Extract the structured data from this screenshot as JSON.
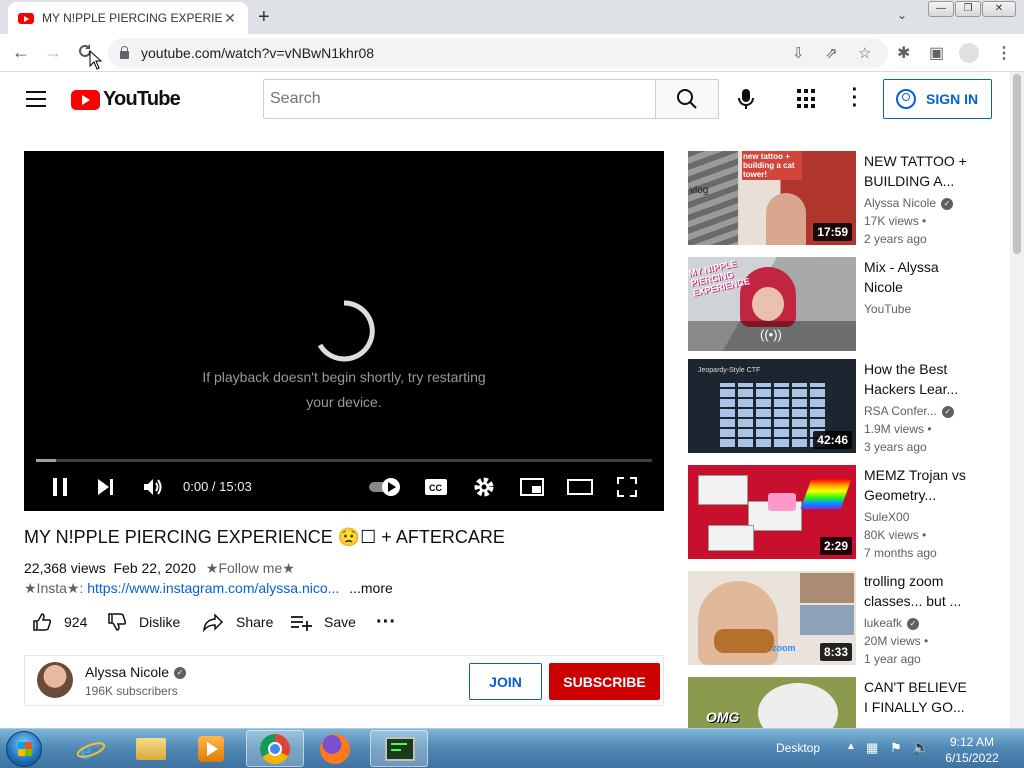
{
  "browser": {
    "tab_title": "MY N!PPLE PIERCING EXPERIENCE",
    "url": "youtube.com/watch?v=vNBwN1khr08"
  },
  "youtube": {
    "logo_text": "YouTube",
    "search_placeholder": "Search",
    "signin_label": "SIGN IN"
  },
  "player": {
    "message_line1": "If playback doesn't begin shortly, try restarting",
    "message_line2": "your device.",
    "time": "0:00 / 15:03"
  },
  "video": {
    "title": "MY N!PPLE PIERCING EXPERIENCE 😟☐ + AFTERCARE",
    "views": "22,368 views",
    "date": "Feb 22, 2020",
    "follow": "★Follow me★",
    "insta_label": "★Insta★:",
    "insta_link": "https://www.instagram.com/alyssa.nico...",
    "more": "...more",
    "likes": "924",
    "dislike_label": "Dislike",
    "share_label": "Share",
    "save_label": "Save"
  },
  "channel": {
    "name": "Alyssa Nicole",
    "subscribers": "196K subscribers",
    "join_label": "JOIN",
    "subscribe_label": "SUBSCRIBE"
  },
  "sidebar": [
    {
      "title": "NEW TATTOO + BUILDING A...",
      "channel": "Alyssa Nicole",
      "verified": true,
      "views": "17K views •",
      "age": "2 years ago",
      "duration": "17:59"
    },
    {
      "title": "Mix - Alyssa Nicole",
      "channel": "YouTube",
      "verified": false,
      "views": "",
      "age": "",
      "duration": ""
    },
    {
      "title": "How the Best Hackers Lear...",
      "channel": "RSA Confer...",
      "verified": true,
      "views": "1.9M views •",
      "age": "3 years ago",
      "duration": "42:46"
    },
    {
      "title": "MEMZ Trojan vs Geometry...",
      "channel": "SuleX00",
      "verified": false,
      "views": "80K views •",
      "age": "7 months ago",
      "duration": "2:29"
    },
    {
      "title": "trolling zoom classes... but ...",
      "channel": "lukeafk",
      "verified": true,
      "views": "20M views •",
      "age": "1 year ago",
      "duration": "8:33"
    },
    {
      "title": "CAN'T BELIEVE I FINALLY GO...",
      "channel": "",
      "verified": false,
      "views": "",
      "age": "",
      "duration": ""
    }
  ],
  "thumb_text": {
    "t1_top": "new tattoo + building a cat tower!",
    "t1_side": "vlog",
    "t2": "MY N!PPLE PIERCING EXPERIENCE",
    "t3": "Jeopardy-Style CTF",
    "t6": "OMG"
  },
  "taskbar": {
    "desktop_label": "Desktop",
    "time": "9:12 AM",
    "date": "6/15/2022"
  },
  "colors": {
    "youtube_red": "#ff0000",
    "subscribe_red": "#cc0000",
    "link_blue": "#065fd4"
  }
}
